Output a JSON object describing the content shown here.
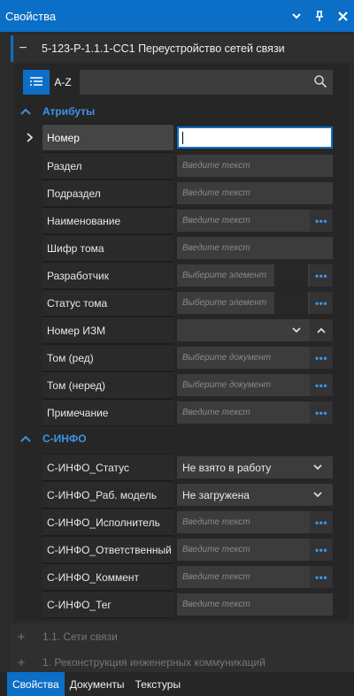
{
  "window": {
    "title": "Свойства"
  },
  "section": {
    "title": "5-123-Р-1.1.1-СС1 Переустройство сетей связи"
  },
  "toolbar": {
    "az_label": "A-Z"
  },
  "groups": {
    "attributes": {
      "title": "Атрибуты",
      "rows": [
        {
          "label": "Номер",
          "value": ""
        },
        {
          "label": "Раздел",
          "placeholder": "Введите текст"
        },
        {
          "label": "Подраздел",
          "placeholder": "Введите текст"
        },
        {
          "label": "Наименование",
          "placeholder": "Введите текст"
        },
        {
          "label": "Шифр тома",
          "placeholder": "Введите текст"
        },
        {
          "label": "Разработчик",
          "placeholder": "Выберите элемент"
        },
        {
          "label": "Статус тома",
          "placeholder": "Выберите элемент"
        },
        {
          "label": "Номер ИЗМ",
          "placeholder": ""
        },
        {
          "label": "Том (ред)",
          "placeholder": "Выберите документ"
        },
        {
          "label": "Том (неред)",
          "placeholder": "Выберите документ"
        },
        {
          "label": "Примечание",
          "placeholder": "Введите текст"
        }
      ]
    },
    "cinfo": {
      "title": "С-ИНФО",
      "rows": [
        {
          "label": "С-ИНФО_Статус",
          "value": "Не взято в работу"
        },
        {
          "label": "С-ИНФО_Раб. модель",
          "value": "Не загружена"
        },
        {
          "label": "С-ИНФО_Исполнитель",
          "placeholder": "Введите текст"
        },
        {
          "label": "С-ИНФО_Ответственный",
          "placeholder": "Введите текст"
        },
        {
          "label": "С-ИНФО_Коммент",
          "placeholder": "Введите текст"
        },
        {
          "label": "С-ИНФО_Тег",
          "placeholder": "Введите текст"
        }
      ]
    }
  },
  "collapsed_sections": [
    {
      "title": "1.1. Сети связи"
    },
    {
      "title": "1. Реконструкция инженерных коммуникаций"
    }
  ],
  "tabs": [
    {
      "label": "Свойства",
      "active": true
    },
    {
      "label": "Документы",
      "active": false
    },
    {
      "label": "Текстуры",
      "active": false
    }
  ],
  "colors": {
    "accent": "#0b6fc7",
    "group_title": "#3b93e6",
    "background": "#2b2b2b"
  },
  "icons": {
    "title_bar": [
      "chevron-down-icon",
      "pin-icon",
      "close-icon"
    ],
    "toolbar": [
      "categorized-list-icon",
      "search-icon"
    ]
  }
}
